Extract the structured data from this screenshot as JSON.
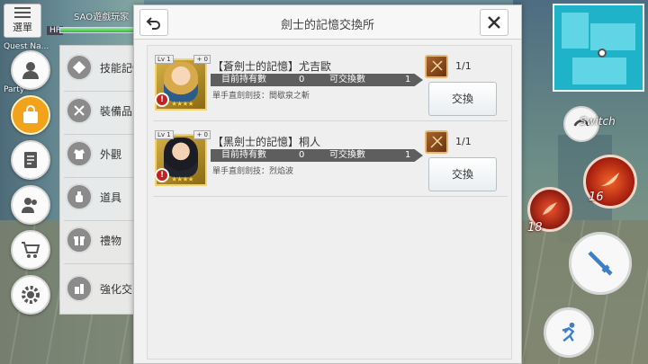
{
  "hud": {
    "menu_label": "選單",
    "player_name": "SAO遊戲玩家",
    "hp_label": "HP",
    "quest_label": "Quest Na...",
    "party_label": "Party",
    "hp_fraction": 0.95
  },
  "submenu": {
    "items": [
      {
        "label": "技能記憶",
        "icon": "skill-memory-icon"
      },
      {
        "label": "裝備品",
        "icon": "equipment-icon"
      },
      {
        "label": "外觀",
        "icon": "outfit-icon"
      },
      {
        "label": "道具",
        "icon": "potion-icon"
      },
      {
        "label": "禮物",
        "icon": "gift-icon"
      },
      {
        "label": "強化交",
        "icon": "enhance-icon"
      }
    ]
  },
  "dialog": {
    "title": "劍士的記憶交換所",
    "rows": [
      {
        "item_name": "【蒼劍士的記憶】尤吉歐",
        "owned_label": "目前持有數",
        "owned_value": "0",
        "exchangeable_label": "可交換數",
        "exchangeable_value": "1",
        "skill": "單手直劍劍技：間歇泉之斬",
        "count": "1/1",
        "exchange_label": "交換",
        "level_tag": "Lv 1",
        "plus_tag": "+ 0",
        "stars": "★★★★"
      },
      {
        "item_name": "【黑劍士的記憶】桐人",
        "owned_label": "目前持有數",
        "owned_value": "0",
        "exchangeable_label": "可交換數",
        "exchangeable_value": "1",
        "skill": "單手直劍劍技：烈焰波",
        "count": "1/1",
        "exchange_label": "交換",
        "level_tag": "Lv 1",
        "plus_tag": "+ 0",
        "stars": "★★★★"
      }
    ]
  },
  "right_hud": {
    "switch_label": "Switch",
    "skill_cd_1": "16",
    "skill_cd_2": "18"
  },
  "colors": {
    "accent": "#f3a21c",
    "minimap": "#1eb3c8",
    "skill_red": "#c62020"
  }
}
